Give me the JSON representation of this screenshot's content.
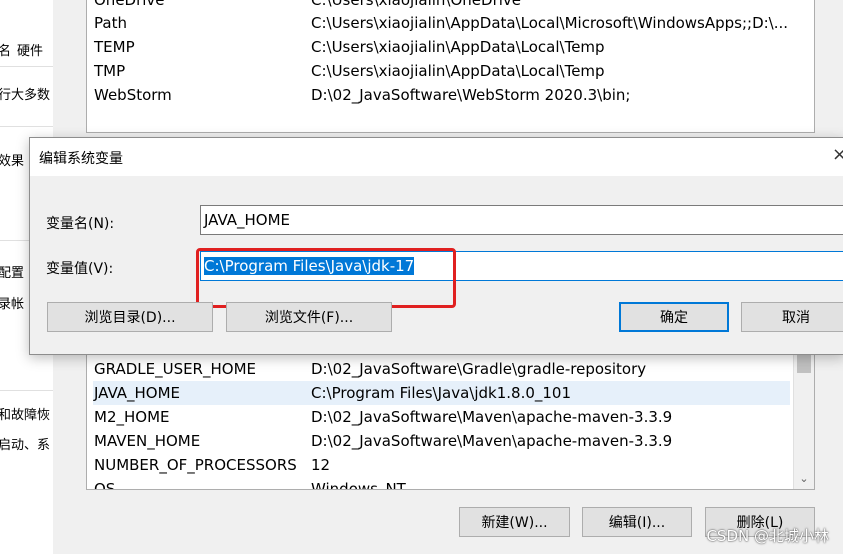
{
  "left_panel": {
    "fragments": [
      "名",
      "硬件",
      "行大多数",
      "效果",
      "配置",
      "录帐",
      "和故障恢",
      "启动、系"
    ]
  },
  "env_window": {
    "top_list": [
      {
        "name": "OneDrive",
        "value": "C:\\Users\\xiaojialin\\OneDrive"
      },
      {
        "name": "Path",
        "value": "C:\\Users\\xiaojialin\\AppData\\Local\\Microsoft\\WindowsApps;;D:\\..."
      },
      {
        "name": "TEMP",
        "value": "C:\\Users\\xiaojialin\\AppData\\Local\\Temp"
      },
      {
        "name": "TMP",
        "value": "C:\\Users\\xiaojialin\\AppData\\Local\\Temp"
      },
      {
        "name": "WebStorm",
        "value": "D:\\02_JavaSoftware\\WebStorm 2020.3\\bin;"
      }
    ],
    "bottom_list": [
      {
        "name": "GRADLE_USER_HOME",
        "value": "D:\\02_JavaSoftware\\Gradle\\gradle-repository"
      },
      {
        "name": "JAVA_HOME",
        "value": "C:\\Program Files\\Java\\jdk1.8.0_101"
      },
      {
        "name": "M2_HOME",
        "value": "D:\\02_JavaSoftware\\Maven\\apache-maven-3.3.9"
      },
      {
        "name": "MAVEN_HOME",
        "value": "D:\\02_JavaSoftware\\Maven\\apache-maven-3.3.9"
      },
      {
        "name": "NUMBER_OF_PROCESSORS",
        "value": "12"
      },
      {
        "name": "OS",
        "value": "Windows_NT"
      }
    ],
    "buttons": {
      "new": "新建(W)...",
      "edit": "编辑(I)...",
      "delete": "删除(L)"
    }
  },
  "dialog": {
    "title": "编辑系统变量",
    "close_glyph": "×",
    "name_label": "变量名(N):",
    "name_value": "JAVA_HOME",
    "value_label": "变量值(V):",
    "value_value": "C:\\Program Files\\Java\\jdk-17",
    "browse_dir": "浏览目录(D)...",
    "browse_file": "浏览文件(F)...",
    "ok": "确定",
    "cancel": "取消"
  },
  "watermark": "CSDN @北城小林",
  "colors": {
    "accent": "#0078d7",
    "annotation": "#e02020"
  }
}
